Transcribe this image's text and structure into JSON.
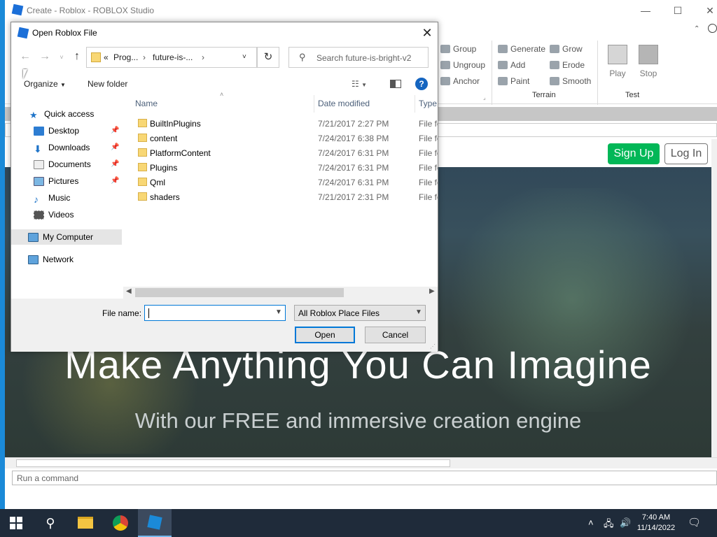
{
  "studio": {
    "title": "Create - Roblox - ROBLOX Studio",
    "ribbon": {
      "groups": [
        {
          "items": [
            "Group",
            "Ungroup",
            "Anchor"
          ]
        },
        {
          "items": [
            "Generate",
            "Add",
            "Paint",
            "Grow",
            "Erode",
            "Smooth"
          ],
          "label": "Terrain"
        },
        {
          "items": [
            "Play",
            "Stop"
          ],
          "label": "Test"
        }
      ]
    },
    "page": {
      "signup_label": "Sign Up",
      "login_label": "Log In",
      "headline": "Make Anything You Can Imagine",
      "subheadline": "With our FREE and immersive creation engine"
    },
    "command_placeholder": "Run a command"
  },
  "dialog": {
    "title": "Open Roblox File",
    "breadcrumb": {
      "prefix": "«",
      "parts": [
        "Prog...",
        "future-is-..."
      ]
    },
    "search_placeholder": "Search future-is-bright-v2",
    "toolbar": {
      "organize": "Organize",
      "new_folder": "New folder"
    },
    "nav": {
      "quick_access": "Quick access",
      "items": [
        "Desktop",
        "Downloads",
        "Documents",
        "Pictures",
        "Music",
        "Videos"
      ],
      "my_computer": "My Computer",
      "network": "Network"
    },
    "columns": {
      "name": "Name",
      "date": "Date modified",
      "type": "Type"
    },
    "files": [
      {
        "name": "BuiltInPlugins",
        "date": "7/21/2017 2:27 PM",
        "type": "File folder"
      },
      {
        "name": "content",
        "date": "7/24/2017 6:38 PM",
        "type": "File folder"
      },
      {
        "name": "PlatformContent",
        "date": "7/24/2017 6:31 PM",
        "type": "File folder"
      },
      {
        "name": "Plugins",
        "date": "7/24/2017 6:31 PM",
        "type": "File folder"
      },
      {
        "name": "Qml",
        "date": "7/24/2017 6:31 PM",
        "type": "File folder"
      },
      {
        "name": "shaders",
        "date": "7/21/2017 2:31 PM",
        "type": "File folder"
      }
    ],
    "file_name_label": "File name:",
    "file_name_value": "",
    "filter_value": "All Roblox Place Files",
    "open_label": "Open",
    "cancel_label": "Cancel"
  },
  "taskbar": {
    "time": "7:40 AM",
    "date": "11/14/2022"
  },
  "colors": {
    "accent": "#0078d7",
    "signup": "#02b757",
    "studio_border": "#1b8ad8",
    "taskbar": "#1f2b3a"
  }
}
